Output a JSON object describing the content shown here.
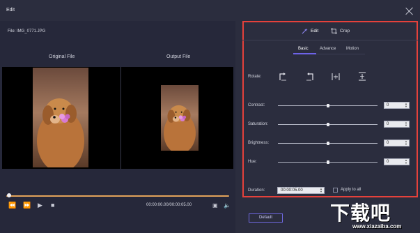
{
  "window": {
    "title": "Edit"
  },
  "file": {
    "label": "File: IMG_0771.JPG"
  },
  "preview": {
    "original_title": "Original File",
    "output_title": "Output File"
  },
  "player": {
    "time": "00:00:00.00/00:00:05.00",
    "progress": 0.02
  },
  "tabs": {
    "edit": "Edit",
    "crop": "Crop"
  },
  "subtabs": {
    "basic": "Basic",
    "advance": "Advance",
    "motion": "Motion"
  },
  "rotate": {
    "label": "Rotate:"
  },
  "sliders": [
    {
      "label": "Contrast:",
      "value": "0",
      "position": 0.5
    },
    {
      "label": "Saturation:",
      "value": "0",
      "position": 0.5
    },
    {
      "label": "Brightness:",
      "value": "0",
      "position": 0.5
    },
    {
      "label": "Hue:",
      "value": "0",
      "position": 0.5
    }
  ],
  "duration": {
    "label": "Duration:",
    "value": "00:00:05.00"
  },
  "apply_all": {
    "label": "Apply to all"
  },
  "default_button": "Default",
  "watermark": {
    "text": "下载吧",
    "url": "www.xiazaiba.com"
  },
  "colors": {
    "accent": "#6d63e8",
    "highlight_border": "#e5413b",
    "seek": "#e2a35a"
  }
}
